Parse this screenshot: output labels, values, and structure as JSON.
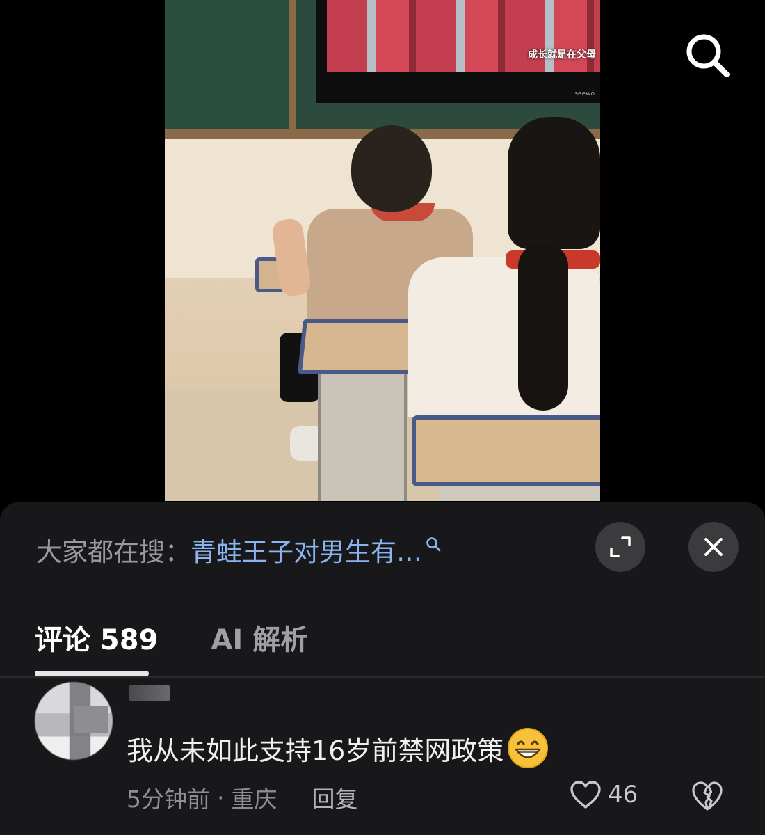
{
  "video": {
    "tv_caption": "成长就是在父母 ",
    "tv_brand": "seewo"
  },
  "search_bar": {
    "prefix": "大家都在搜：",
    "query": "青蛙王子对男生有…"
  },
  "tabs": [
    {
      "label": "评论 589",
      "active": true
    },
    {
      "label": "AI 解析",
      "active": false
    }
  ],
  "comment": {
    "text": "我从未如此支持16岁前禁网政策",
    "emoji": "grinning-face",
    "time": "5分钟前",
    "separator": "·",
    "location": "重庆",
    "reply_label": "回复",
    "like_count": "46"
  },
  "icons": {
    "search": "search-icon",
    "expand": "expand-icon",
    "close": "close-icon",
    "like": "heart-icon",
    "dislike": "broken-heart-icon"
  },
  "colors": {
    "background": "#000000",
    "sheet": "#18181a",
    "link_blue": "#8ab4ef",
    "muted_text": "#9a9a9e"
  }
}
